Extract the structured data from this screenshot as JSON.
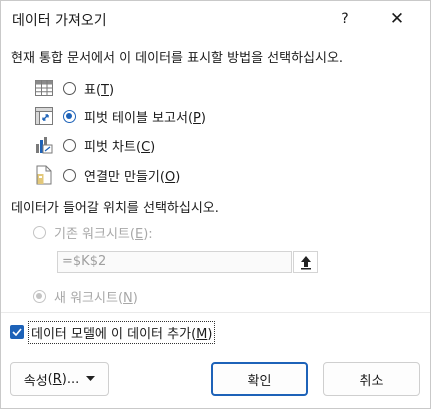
{
  "window": {
    "title": "데이터 가져오기",
    "help_label": "?",
    "close_label": "✕"
  },
  "display_section": {
    "prompt": "현재 통합 문서에서 이 데이터를 표시할 방법을 선택하십시오.",
    "options": [
      {
        "label": "표",
        "mnemonic": "T",
        "checked": false,
        "icon": "table-icon"
      },
      {
        "label": "피벗 테이블 보고서",
        "mnemonic": "P",
        "checked": true,
        "icon": "pivottable-icon"
      },
      {
        "label": "피벗 차트",
        "mnemonic": "C",
        "checked": false,
        "icon": "pivotchart-icon"
      },
      {
        "label": "연결만 만들기",
        "mnemonic": "O",
        "checked": false,
        "icon": "connection-only-icon"
      }
    ]
  },
  "location_section": {
    "prompt": "데이터가 들어갈 위치를 선택하십시오.",
    "existing_sheet": {
      "label": "기존 워크시트",
      "mnemonic": "E",
      "suffix": ":",
      "checked": false,
      "enabled": false
    },
    "reference_value": "=$K$2",
    "new_sheet": {
      "label": "새 워크시트",
      "mnemonic": "N",
      "checked": true,
      "enabled": false
    }
  },
  "data_model": {
    "label": "데이터 모델에 이 데이터 추가",
    "mnemonic": "M",
    "checked": true
  },
  "buttons": {
    "properties": {
      "label": "속성",
      "mnemonic": "R",
      "suffix": "..."
    },
    "ok": "확인",
    "cancel": "취소"
  },
  "colors": {
    "accent": "#1d62b8",
    "disabled": "#a8a8a8"
  }
}
